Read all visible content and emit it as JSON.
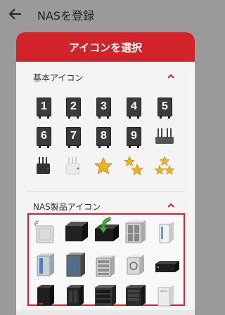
{
  "appbar": {
    "title": "NASを登録"
  },
  "dialog": {
    "title": "アイコンを選択",
    "basic_section": {
      "title": "基本アイコン",
      "numbers": [
        "1",
        "2",
        "3",
        "4",
        "5",
        "6",
        "7",
        "8",
        "9"
      ]
    },
    "nas_section": {
      "title": "NAS製品アイコン"
    }
  },
  "colors": {
    "accent": "#d2232a",
    "scrim": "#9a9a9a",
    "star": "#f2b21c"
  }
}
